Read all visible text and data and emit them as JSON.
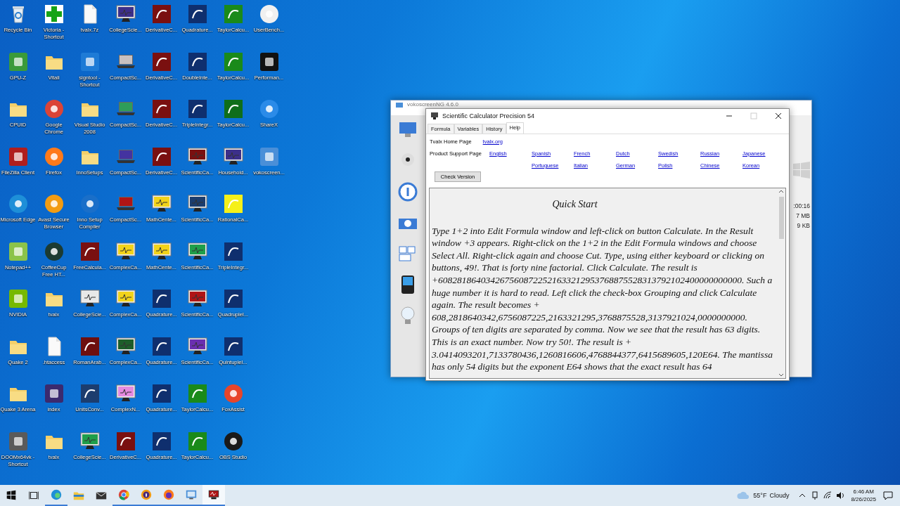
{
  "desktop_icons": [
    {
      "label": "Recycle Bin",
      "kind": "bin"
    },
    {
      "label": "GPU-Z",
      "kind": "app",
      "color": "#3a9a3a"
    },
    {
      "label": "CPUID",
      "kind": "folder"
    },
    {
      "label": "FileZilla Client",
      "kind": "app",
      "color": "#b01e1e"
    },
    {
      "label": "Microsoft Edge",
      "kind": "round",
      "color": "#1e8fd8"
    },
    {
      "label": "Notepad++",
      "kind": "app",
      "color": "#8bc34a"
    },
    {
      "label": "NVIDIA",
      "kind": "app",
      "color": "#76b900"
    },
    {
      "label": "Quake 2",
      "kind": "folder"
    },
    {
      "label": "Quake 3 Arena",
      "kind": "folder"
    },
    {
      "label": "DOOMx64vk - Shortcut",
      "kind": "app",
      "color": "#5a5a5a"
    },
    {
      "label": "Victoria - Shortcut",
      "kind": "plus",
      "color": "#17a317"
    },
    {
      "label": "Vitali",
      "kind": "folder"
    },
    {
      "label": "Google Chrome",
      "kind": "round",
      "color": "#db4437"
    },
    {
      "label": "Firefox",
      "kind": "round",
      "color": "#ff7a1a"
    },
    {
      "label": "Avast Secure Browser",
      "kind": "round",
      "color": "#f39c12"
    },
    {
      "label": "CoffeeCup Free HT...",
      "kind": "round",
      "color": "#1c3b32"
    },
    {
      "label": "tvalx",
      "kind": "folder"
    },
    {
      "label": ".htaccess",
      "kind": "file"
    },
    {
      "label": "index",
      "kind": "app",
      "color": "#3b2a6e"
    },
    {
      "label": "tvalx",
      "kind": "folder"
    },
    {
      "label": "tvalx.7z",
      "kind": "file"
    },
    {
      "label": "signtool - Shortcut",
      "kind": "app",
      "color": "#1e7bd6"
    },
    {
      "label": "Visual Studio 2008",
      "kind": "folder"
    },
    {
      "label": "InnoSetups",
      "kind": "folder"
    },
    {
      "label": "Inno Setup Compiler",
      "kind": "round",
      "color": "#1a6fc9"
    },
    {
      "label": "FreeCalcula...",
      "kind": "tile",
      "color": "#7a1010"
    },
    {
      "label": "CollegeScie...",
      "kind": "monitor",
      "color": "#e8e8e8"
    },
    {
      "label": "RomanArab...",
      "kind": "tile",
      "color": "#6e0f0f"
    },
    {
      "label": "UnitsConv...",
      "kind": "tile",
      "color": "#1c3d6e"
    },
    {
      "label": "CollegeScie...",
      "kind": "monitor",
      "color": "#1f9e4a"
    },
    {
      "label": "CollegeScie...",
      "kind": "monitor",
      "color": "#3c2f8a"
    },
    {
      "label": "CompactSc...",
      "kind": "laptop",
      "color": "#c8c0c0"
    },
    {
      "label": "CompactSc...",
      "kind": "laptop",
      "color": "#2f9d5a"
    },
    {
      "label": "CompactSc...",
      "kind": "laptop",
      "color": "#4433a0"
    },
    {
      "label": "CompactSc...",
      "kind": "laptop",
      "color": "#b01515"
    },
    {
      "label": "ComplexCa...",
      "kind": "monitor",
      "color": "#f2d31a"
    },
    {
      "label": "ComplexCa...",
      "kind": "monitor",
      "color": "#f2d31a"
    },
    {
      "label": "ComplexCa...",
      "kind": "monitor",
      "color": "#1d5e2a"
    },
    {
      "label": "ComplexN...",
      "kind": "monitor",
      "color": "#e58ae0"
    },
    {
      "label": "DerivativeC...",
      "kind": "tile",
      "color": "#7a1010"
    },
    {
      "label": "DerivativeC...",
      "kind": "tile",
      "color": "#7a1010"
    },
    {
      "label": "DerivativeC...",
      "kind": "tile",
      "color": "#7a1010"
    },
    {
      "label": "DerivativeC...",
      "kind": "tile",
      "color": "#7a1010"
    },
    {
      "label": "DerivativeC...",
      "kind": "tile",
      "color": "#7a1010"
    },
    {
      "label": "MathCente...",
      "kind": "monitor",
      "color": "#f2d31a"
    },
    {
      "label": "MathCente...",
      "kind": "monitor",
      "color": "#f2d31a"
    },
    {
      "label": "Quadrature...",
      "kind": "tile",
      "color": "#0f2f6e"
    },
    {
      "label": "Quadrature...",
      "kind": "tile",
      "color": "#0f2f6e"
    },
    {
      "label": "Quadrature...",
      "kind": "tile",
      "color": "#0f2f6e"
    },
    {
      "label": "Quadrature...",
      "kind": "tile",
      "color": "#0f2f6e"
    },
    {
      "label": "Quadrature...",
      "kind": "tile",
      "color": "#0f2f6e"
    },
    {
      "label": "DoubleInte...",
      "kind": "tile",
      "color": "#0f2f6e"
    },
    {
      "label": "TripleIntegr...",
      "kind": "tile",
      "color": "#0f2f6e"
    },
    {
      "label": "ScientificCa...",
      "kind": "monitor",
      "color": "#7a1010"
    },
    {
      "label": "ScientificCa...",
      "kind": "monitor",
      "color": "#1c3d6e"
    },
    {
      "label": "ScientificCa...",
      "kind": "monitor",
      "color": "#1f9e4a"
    },
    {
      "label": "ScientificCa...",
      "kind": "monitor",
      "color": "#b01515"
    },
    {
      "label": "ScientificCa...",
      "kind": "monitor",
      "color": "#6a2fb0"
    },
    {
      "label": "TaylorCalcu...",
      "kind": "tile",
      "color": "#1a8a1a"
    },
    {
      "label": "TaylorCalcu...",
      "kind": "tile",
      "color": "#1a8a1a"
    },
    {
      "label": "TaylorCalcu...",
      "kind": "tile",
      "color": "#1a8a1a"
    },
    {
      "label": "TaylorCalcu...",
      "kind": "tile",
      "color": "#1a8a1a"
    },
    {
      "label": "TaylorCalcu...",
      "kind": "tile",
      "color": "#0f6e1a"
    },
    {
      "label": "Household...",
      "kind": "monitor",
      "color": "#3c2f8a"
    },
    {
      "label": "RationalCa...",
      "kind": "tile",
      "color": "#f5f01a"
    },
    {
      "label": "TripleIntegr...",
      "kind": "tile",
      "color": "#0f2f6e"
    },
    {
      "label": "QuadrupleI...",
      "kind": "tile",
      "color": "#0f2f6e"
    },
    {
      "label": "QuintupleI...",
      "kind": "tile",
      "color": "#0f2f6e"
    },
    {
      "label": "FoxAssist",
      "kind": "round",
      "color": "#e8452a"
    },
    {
      "label": "OBS Studio",
      "kind": "round",
      "color": "#1a1a1a"
    },
    {
      "label": "UserBench...",
      "kind": "round",
      "color": "#f0f0f0"
    },
    {
      "label": "Performan...",
      "kind": "app",
      "color": "#111111"
    },
    {
      "label": "ShareX",
      "kind": "round",
      "color": "#2b8be8"
    },
    {
      "label": "vokoscreen...",
      "kind": "app",
      "color": "#4a8fd8"
    }
  ],
  "background_window": {
    "title": "vokoscreenNG 4.6.0",
    "readouts": [
      ":00:16",
      "7 MB",
      "9 KB"
    ]
  },
  "calculator": {
    "title": "Scientific Calculator Precision 54",
    "tabs": [
      {
        "label": "Formula",
        "selected": false
      },
      {
        "label": "Variables",
        "selected": false
      },
      {
        "label": "History",
        "selected": false
      },
      {
        "label": "Help",
        "selected": true
      }
    ],
    "home_page": {
      "label": "Tvalx Home Page",
      "link": "tvalx.org"
    },
    "support": {
      "label": "Product Support Page",
      "links": [
        {
          "top": "English"
        },
        {
          "top": "Spanish",
          "bottom": "Portuguese"
        },
        {
          "top": "French",
          "bottom": "Italian"
        },
        {
          "top": "Dutch",
          "bottom": "German"
        },
        {
          "top": "Swedish",
          "bottom": "Polish"
        },
        {
          "top": "Russian",
          "bottom": "Chinese"
        },
        {
          "top": "Japanese",
          "bottom": "Korean"
        }
      ]
    },
    "check_button": "Check Version",
    "help": {
      "heading": "Quick Start",
      "body": "Type 1+2 into Edit Formula window and left-click on button Calculate. In the Result window +3 appears. Right-click on the 1+2 in the Edit Formula windows and choose Select All. Right-click again and choose Cut. Type, using either keyboard or clicking on buttons, 49!. That is forty nine factorial. Click Calculate. The result is +6082818640342675608722521633212953768875528313792102400000000000. Such a huge number it is hard to read. Left click the check-box Grouping and click Calculate again. The result becomes + 608,2818640342,6756087225,2163321295,3768875528,3137921024,0000000000. Groups of ten digits are separated by comma. Now we see that the result has 63 digits. This is an exact number. Now try 50!. The result is + 3.0414093201,7133780436,1260816606,4768844377,6415689605,120E64. The mantissa has only 54 digits but the exponent E64 shows that the exact result has 64"
    }
  },
  "taskbar": {
    "apps": [
      {
        "kind": "edge",
        "running": true,
        "selected": false
      },
      {
        "kind": "explorer",
        "running": false,
        "selected": false
      },
      {
        "kind": "mail",
        "running": false,
        "selected": false
      },
      {
        "kind": "chrome",
        "running": true,
        "selected": false
      },
      {
        "kind": "avast",
        "running": true,
        "selected": false
      },
      {
        "kind": "firefox",
        "running": true,
        "selected": false
      },
      {
        "kind": "recorder",
        "running": true,
        "selected": false
      },
      {
        "kind": "calculator",
        "running": true,
        "selected": true
      }
    ],
    "weather": {
      "temperature": "55°F",
      "condition": "Cloudy"
    },
    "clock": {
      "time": "6:46 AM",
      "date": "8/26/2025"
    }
  }
}
